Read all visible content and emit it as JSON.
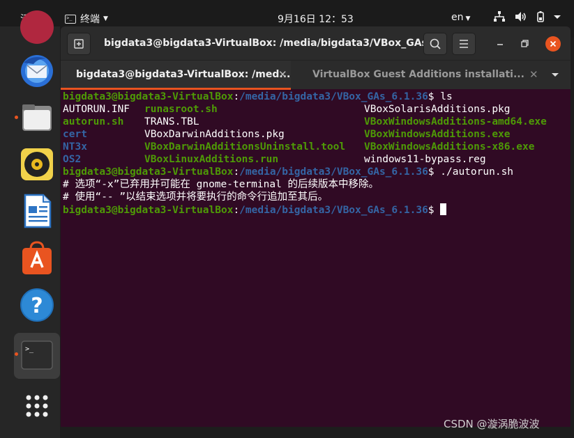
{
  "topbar": {
    "activities": "活动",
    "app_menu": "终端",
    "clock": "9月16日  12：53",
    "lang": "en"
  },
  "dock": {
    "apps": [
      {
        "name": "thunderbird-icon"
      },
      {
        "name": "files-icon"
      },
      {
        "name": "rhythmbox-icon"
      },
      {
        "name": "libreoffice-writer-icon"
      },
      {
        "name": "ubuntu-software-icon"
      },
      {
        "name": "help-icon"
      },
      {
        "name": "terminal-icon"
      },
      {
        "name": "show-applications-icon"
      }
    ]
  },
  "window": {
    "title": "bigdata3@bigdata3-VirtualBox: /media/bigdata3/VBox_GAs...",
    "tabs": [
      {
        "label": "bigdata3@bigdata3-VirtualBox: /med...",
        "active": true
      },
      {
        "label": "VirtualBox Guest Additions installati...",
        "active": false
      }
    ]
  },
  "terminal": {
    "prompt_user": "bigdata3@bigdata3-VirtualBox",
    "prompt_path": "/media/bigdata3/VBox_GAs_6.1.36",
    "cmd1": "ls",
    "ls_rows": [
      [
        "AUTORUN.INF",
        "runasroot.sh",
        "VBoxSolarisAdditions.pkg"
      ],
      [
        "autorun.sh",
        "TRANS.TBL",
        "VBoxWindowsAdditions-amd64.exe"
      ],
      [
        "cert",
        "VBoxDarwinAdditions.pkg",
        "VBoxWindowsAdditions.exe"
      ],
      [
        "NT3x",
        "VBoxDarwinAdditionsUninstall.tool",
        "VBoxWindowsAdditions-x86.exe"
      ],
      [
        "OS2",
        "VBoxLinuxAdditions.run",
        "windows11-bypass.reg"
      ]
    ],
    "cmd2": "./autorun.sh",
    "msg1": "# 选项“-x”已弃用并可能在 gnome-terminal 的后续版本中移除。",
    "msg2": "# 使用“-- ”以结束选项并将要执行的命令行追加至其后。"
  },
  "watermark": "CSDN @漩涡脆波波"
}
